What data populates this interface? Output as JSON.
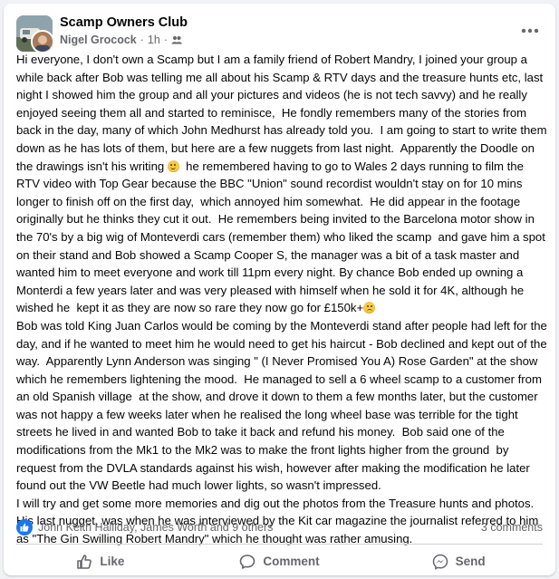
{
  "post": {
    "group_name": "Scamp Owners Club",
    "author": "Nigel Grocock",
    "time": "1h",
    "separator": "·",
    "more_icon": "more-horizontal-icon",
    "paragraph_1a": "Hi everyone, I don't own a Scamp but I am a family friend of Robert Mandry, I joined your group a while back after Bob was telling me all about his Scamp & RTV days and the treasure hunts etc, last night I showed him the group and all your pictures and videos (he is not tech savvy) and he really enjoyed seeing them all and started to reminisce,  He fondly remembers many of the stories from back in the day, many of which John Medhurst has already told you.  I am going to start to write them down as he has lots of them, but here are a few nuggets from last night.  Apparently the Doodle on the drawings isn't his writing ",
    "paragraph_1b": "  he remembered having to go to Wales 2 days running to film the RTV video with Top Gear because the BBC \"Union\" sound recordist wouldn't stay on for 10 mins longer to finish off on the first day,  which annoyed him somewhat.  He did appear in the footage originally but he thinks they cut it out.  He remembers being invited to the Barcelona motor show in the 70's by a big wig of Monteverdi cars (remember them) who liked the scamp  and gave him a spot on their stand and Bob showed a Scamp Cooper S, the manager was a bit of a task master and wanted him to meet everyone and work till 11pm every night. By chance Bob ended up owning a Monterdi a few years later and was very pleased with himself when he sold it for 4K, although he wished he  kept it as they are now so rare they now go for £150k+",
    "paragraph_2": "Bob was told King Juan Carlos would be coming by the Monteverdi stand after people had left for the day, and if he wanted to meet him he would need to get his haircut - Bob declined and kept out of the way.  Apparently Lynn Anderson was singing \" (I Never Promised You A) Rose Garden\" at the show which he remembers lightening the mood.  He managed to sell a 6 wheel scamp to a customer from an old Spanish village  at the show, and drove it down to them a few months later, but the customer was not happy a few weeks later when he realised the long wheel base was terrible for the tight streets he lived in and wanted Bob to take it back and refund his money.  Bob said one of the modifications from the Mk1 to the Mk2 was to make the front lights higher from the ground  by request from the DVLA standards against his wish, however after making the modification he later found out the VW Beetle had much lower lights, so wasn't impressed.",
    "paragraph_3": "I will try and get some more memories and dig out the photos from the Treasure hunts and photos.  His last nugget, was when he was interviewed by the Kit car magazine the journalist referred to him as \"The Gin Swilling Robert Mandry\" which he thought was rather amusing."
  },
  "reactions": {
    "summary": "John Keith Halliday, James Worth and 9 others",
    "comments": "3 comments"
  },
  "actions": {
    "like": "Like",
    "comment": "Comment",
    "send": "Send"
  },
  "colors": {
    "accent": "#1877f2",
    "secondary_text": "#65676b",
    "background": "#f0f2f5"
  }
}
